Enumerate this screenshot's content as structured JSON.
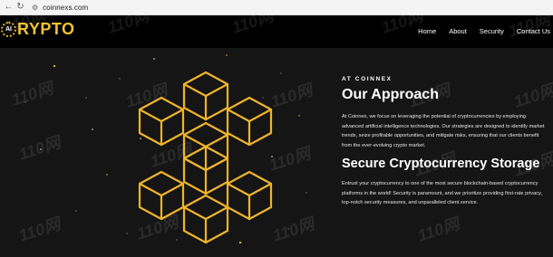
{
  "browser": {
    "back_icon": "back-arrow-icon",
    "reload_icon": "reload-icon",
    "site_info_icon": "site-info-icon",
    "url": "coinnexs.com"
  },
  "header": {
    "logo_badge": "AI",
    "logo_text": "RYPTO",
    "nav": [
      "Home",
      "About",
      "Security",
      "Contact Us"
    ]
  },
  "main": {
    "eyebrow": "AT COINNEX",
    "approach_title": "Our Approach",
    "approach_text": "At Coinnex, we focus on leveraging the potential of cryptocurrencies by employing advanced artificial intelligence technologies. Our strategies are designed to identify market trends, seize profitable opportunities, and mitigate risks, ensuring that our clients benefit from the ever-evolving crypto market.",
    "secure_title": "Secure Cryptocurrency Storage",
    "secure_text": "Entrust your cryptocurrency to one of the most secure blockchain-based cryptocurrency platforms in the world! Security is paramount, and we prioritize providing first-rate privacy, top-notch security measures, and unparalleled client service."
  },
  "watermark": "110网",
  "colors": {
    "accent": "#f1c232",
    "cube_stroke": "#f0b429",
    "background": "#151515",
    "header_bg": "#000000"
  }
}
